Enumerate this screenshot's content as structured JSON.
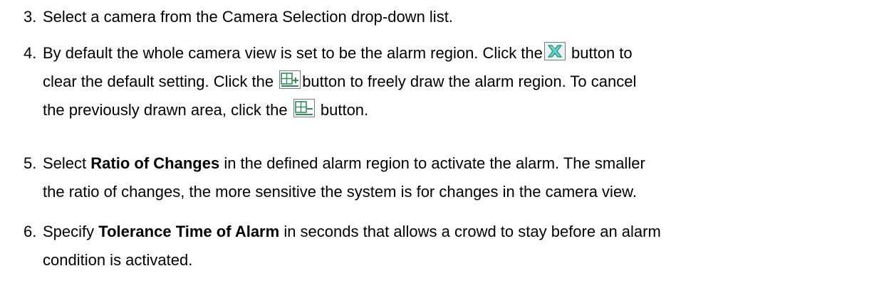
{
  "steps": [
    {
      "number": "3.",
      "text": "Select a camera from the Camera Selection drop-down list."
    },
    {
      "number": "4.",
      "line1_a": "By default the whole camera view is set to be the alarm region. Click the",
      "line1_b": "button to",
      "line2_a": "clear the default setting. Click the",
      "line2_b": "button to freely draw the alarm region. To cancel",
      "line3_a": "the previously drawn area, click the",
      "line3_b": "button."
    },
    {
      "number": "5.",
      "line1_a": "Select",
      "line1_bold": "Ratio of Changes",
      "line1_b": "in the defined alarm region to activate the alarm. The smaller",
      "line2": "the ratio of changes, the more sensitive the system is for changes in the camera view."
    },
    {
      "number": "6.",
      "line1_a": "Specify",
      "line1_bold": "Tolerance Time of Alarm",
      "line1_b": "in seconds that allows a crowd to stay before an alarm",
      "line2": "condition is activated."
    }
  ],
  "icons": {
    "clear": "clear-region-icon",
    "add": "add-region-icon",
    "remove": "remove-region-icon"
  },
  "colors": {
    "icon_green": "#2e8b57",
    "icon_cyan": "#5fd3e6",
    "icon_border": "#7a7a7a"
  }
}
